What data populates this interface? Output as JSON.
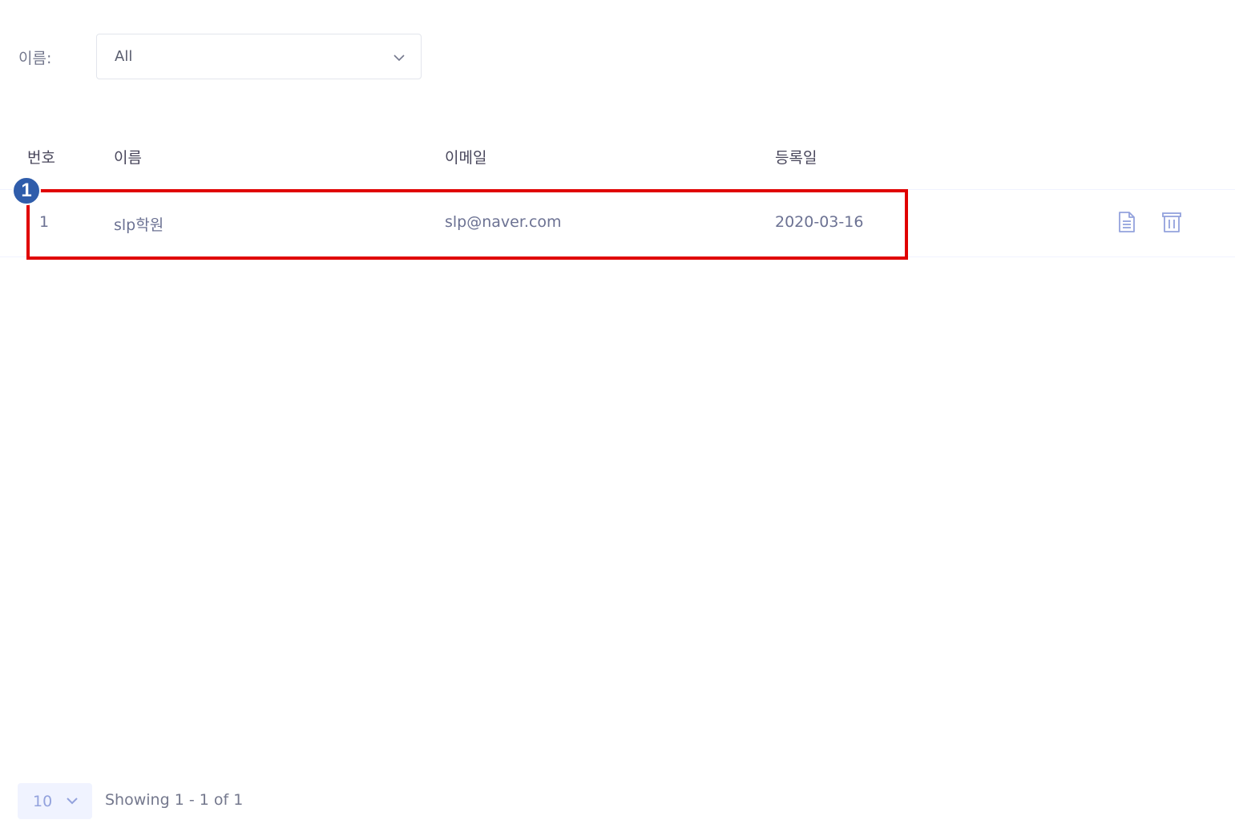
{
  "filter": {
    "label": "이름:",
    "selected": "All"
  },
  "table": {
    "headers": [
      "번호",
      "이름",
      "이메일",
      "등록일"
    ],
    "rows": [
      {
        "no": "1",
        "name": "slp학원",
        "email": "slp@naver.com",
        "date": "2020-03-16"
      }
    ],
    "actions": [
      "document-icon",
      "trash-icon"
    ]
  },
  "annotation": {
    "step": "1",
    "color": "#e00000",
    "badge_color": "#2f5dab"
  },
  "footer": {
    "page_size": "10",
    "showing": "Showing 1 - 1 of 1"
  }
}
